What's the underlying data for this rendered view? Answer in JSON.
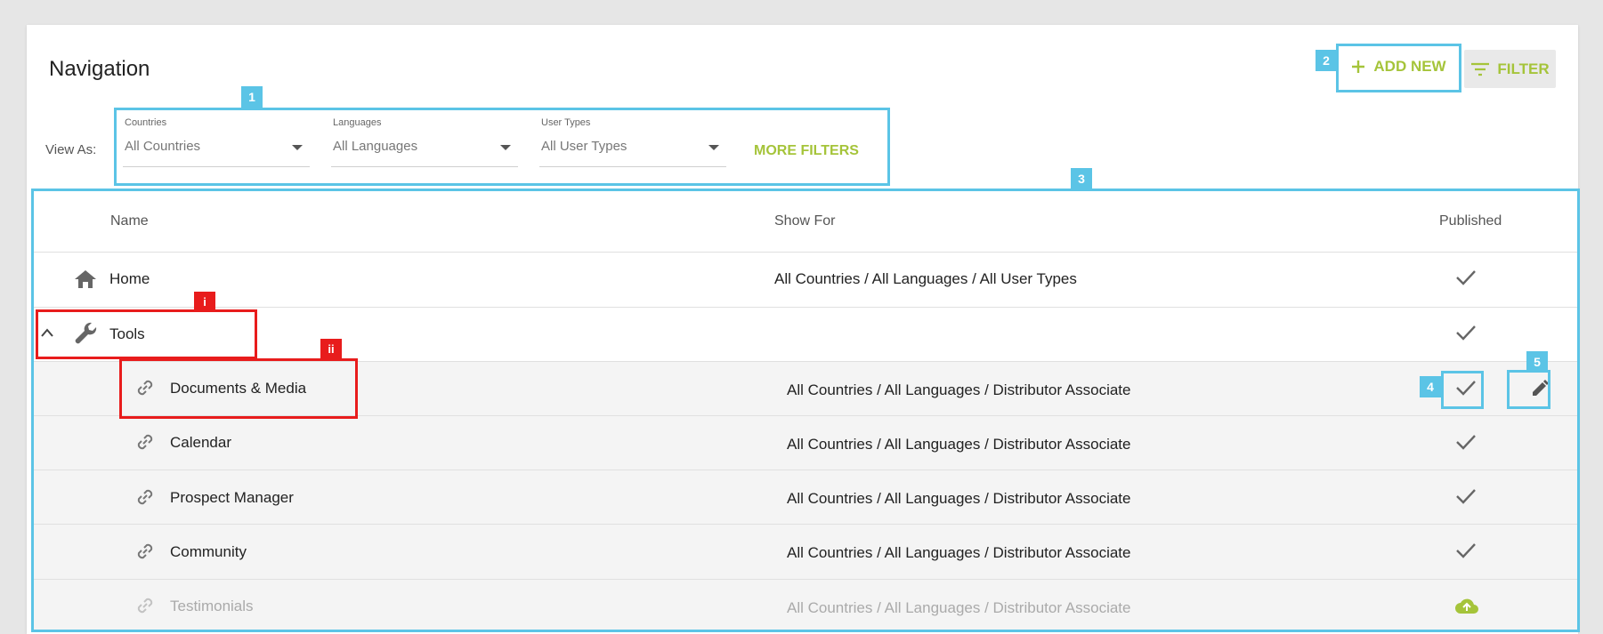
{
  "page": {
    "title": "Navigation",
    "add_new_label": "ADD NEW",
    "filter_label": "FILTER",
    "accent_color": "#a5c43a",
    "annotation_color": "#5bc4e6",
    "highlight_color": "#e81c1c"
  },
  "filters": {
    "view_as_label": "View As:",
    "countries": {
      "label": "Countries",
      "value": "All Countries"
    },
    "languages": {
      "label": "Languages",
      "value": "All Languages"
    },
    "user_types": {
      "label": "User Types",
      "value": "All User Types"
    },
    "more_filters_label": "MORE FILTERS"
  },
  "table": {
    "headers": {
      "name": "Name",
      "show_for": "Show For",
      "published": "Published"
    },
    "rows": [
      {
        "name": "Home",
        "icon": "home-icon",
        "show_for": "All Countries / All Languages / All User Types",
        "published": "check-icon"
      },
      {
        "name": "Tools",
        "icon": "wrench-icon",
        "show_for": "",
        "published": "check-icon",
        "expanded": true
      },
      {
        "name": "Documents & Media",
        "icon": "link-icon",
        "show_for": "All Countries / All Languages / Distributor Associate",
        "published": "check-icon"
      },
      {
        "name": "Calendar",
        "icon": "link-icon",
        "show_for": "All Countries / All Languages / Distributor Associate",
        "published": "check-icon"
      },
      {
        "name": "Prospect Manager",
        "icon": "link-icon",
        "show_for": "All Countries / All Languages / Distributor Associate",
        "published": "check-icon"
      },
      {
        "name": "Community",
        "icon": "link-icon",
        "show_for": "All Countries / All Languages / Distributor Associate",
        "published": "check-icon"
      },
      {
        "name": "Testimonials",
        "icon": "link-icon",
        "show_for": "All Countries / All Languages / Distributor Associate",
        "published": "cloud-upload-icon",
        "unpublished": true
      }
    ]
  },
  "annotations": {
    "tag_1": "1",
    "tag_2": "2",
    "tag_3": "3",
    "tag_4": "4",
    "tag_5": "5",
    "tag_i": "i",
    "tag_ii": "ii"
  }
}
